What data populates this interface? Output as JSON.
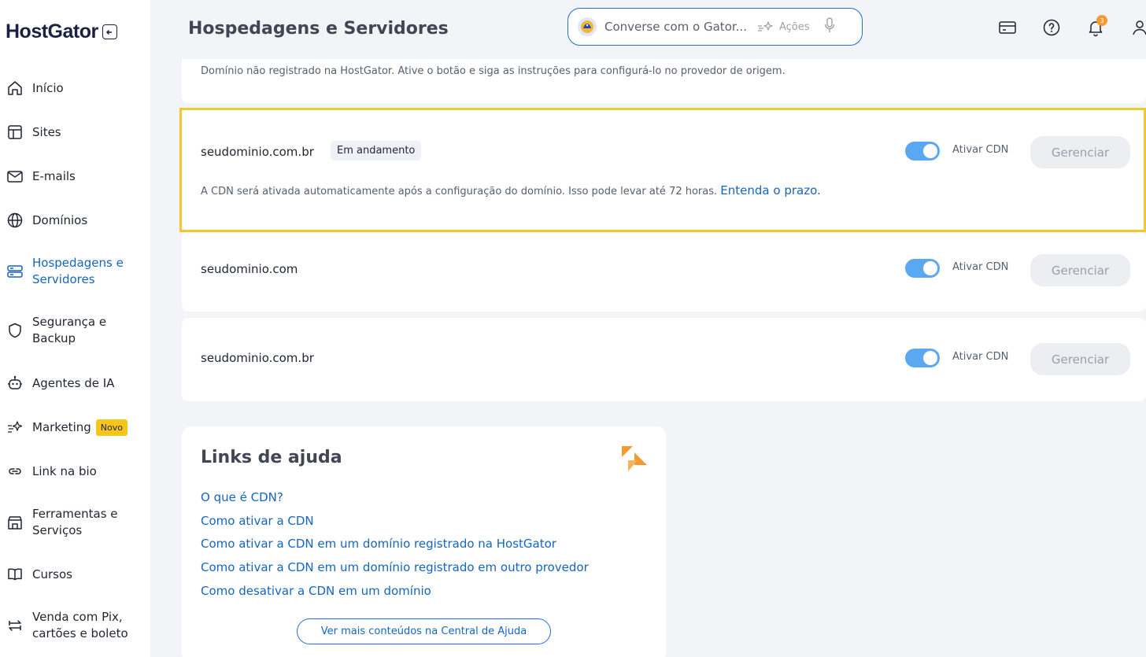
{
  "brand": {
    "logo": "HostGator"
  },
  "sidebar": {
    "items": [
      {
        "label": "Início"
      },
      {
        "label": "Sites"
      },
      {
        "label": "E-mails"
      },
      {
        "label": "Domínios"
      },
      {
        "label": "Hospedagens e Servidores"
      },
      {
        "label": "Segurança e Backup"
      },
      {
        "label": "Agentes de IA"
      },
      {
        "label": "Marketing",
        "badge": "Novo"
      },
      {
        "label": "Link na bio"
      },
      {
        "label": "Ferramentas e Serviços"
      },
      {
        "label": "Cursos"
      },
      {
        "label": "Venda com Pix, cartões e boleto"
      }
    ]
  },
  "header": {
    "title": "Hospedagens e Servidores",
    "search_placeholder": "Converse com o Gator...",
    "actions_label": "Ações",
    "notification_count": "3"
  },
  "main": {
    "top_note": "Domínio não registrado na HostGator. Ative o botão e siga as instruções para configurá-lo no provedor de origem.",
    "domains": [
      {
        "name": "seudominio.com.br",
        "status": "Em andamento",
        "cdn_label": "Ativar CDN",
        "cdn_enabled": true,
        "manage_label": "Gerenciar",
        "description": "A CDN será ativada automaticamente após a configuração do domínio. Isso pode levar até 72 horas.",
        "description_link": "Entenda o prazo."
      },
      {
        "name": "seudominio.com",
        "cdn_label": "Ativar CDN",
        "cdn_enabled": true,
        "manage_label": "Gerenciar"
      },
      {
        "name": "seudominio.com.br",
        "cdn_label": "Ativar CDN",
        "cdn_enabled": true,
        "manage_label": "Gerenciar"
      }
    ]
  },
  "help": {
    "title": "Links de ajuda",
    "links": [
      "O que é CDN?",
      "Como ativar a CDN",
      "Como ativar a CDN em um domínio registrado na HostGator",
      "Como ativar a CDN em um domínio registrado em outro provedor",
      "Como desativar a CDN em um domínio"
    ],
    "more_button": "Ver mais conteúdos na Central de Ajuda"
  },
  "colors": {
    "accent": "#1565c0",
    "highlight": "#f1c92e",
    "toggle_on": "#5aa8f2",
    "badge": "#f7c51b"
  }
}
